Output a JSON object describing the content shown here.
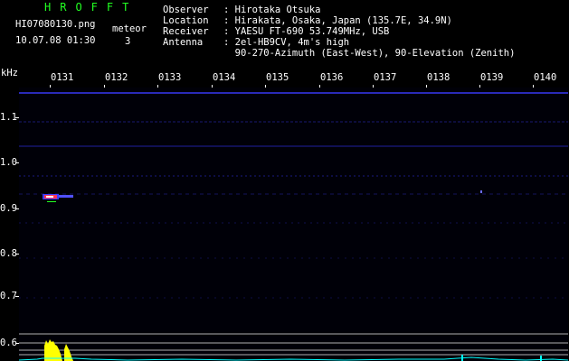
{
  "app": {
    "title": "HROFFT",
    "file_name": "HI07080130.png",
    "date_time": "10.07.08 01:30",
    "meteor_label": "meteor",
    "meteor_count": "3"
  },
  "station_info": [
    {
      "key": "Observer",
      "value": "Hirotaka Otsuka"
    },
    {
      "key": "Location",
      "value": "Hirakata, Osaka, Japan (135.7E, 34.9N)"
    },
    {
      "key": "Receiver",
      "value": "YAESU FT-690 53.749MHz, USB"
    },
    {
      "key": "Antenna",
      "value": "2el-HB9CV, 4m's high"
    },
    {
      "key": "",
      "value": "90-270-Azimuth (East-West), 90-Elevation (Zenith)"
    }
  ],
  "axes": {
    "y_unit": "kHz",
    "x_ticks": [
      "0131",
      "0132",
      "0133",
      "0134",
      "0135",
      "0136",
      "0137",
      "0138",
      "0139",
      "0140"
    ],
    "y_ticks": [
      "1.1",
      "1.0",
      "0.9",
      "0.8",
      "0.7",
      "0.6"
    ]
  },
  "colors": {
    "title": "#22ff22",
    "text": "#ffffff",
    "background": "#000000",
    "signal_lines": "#2020a0",
    "meteor_head": "#ff3355",
    "spectrum_yellow": "#ffff00",
    "spectrum_cyan": "#00ffff"
  }
}
